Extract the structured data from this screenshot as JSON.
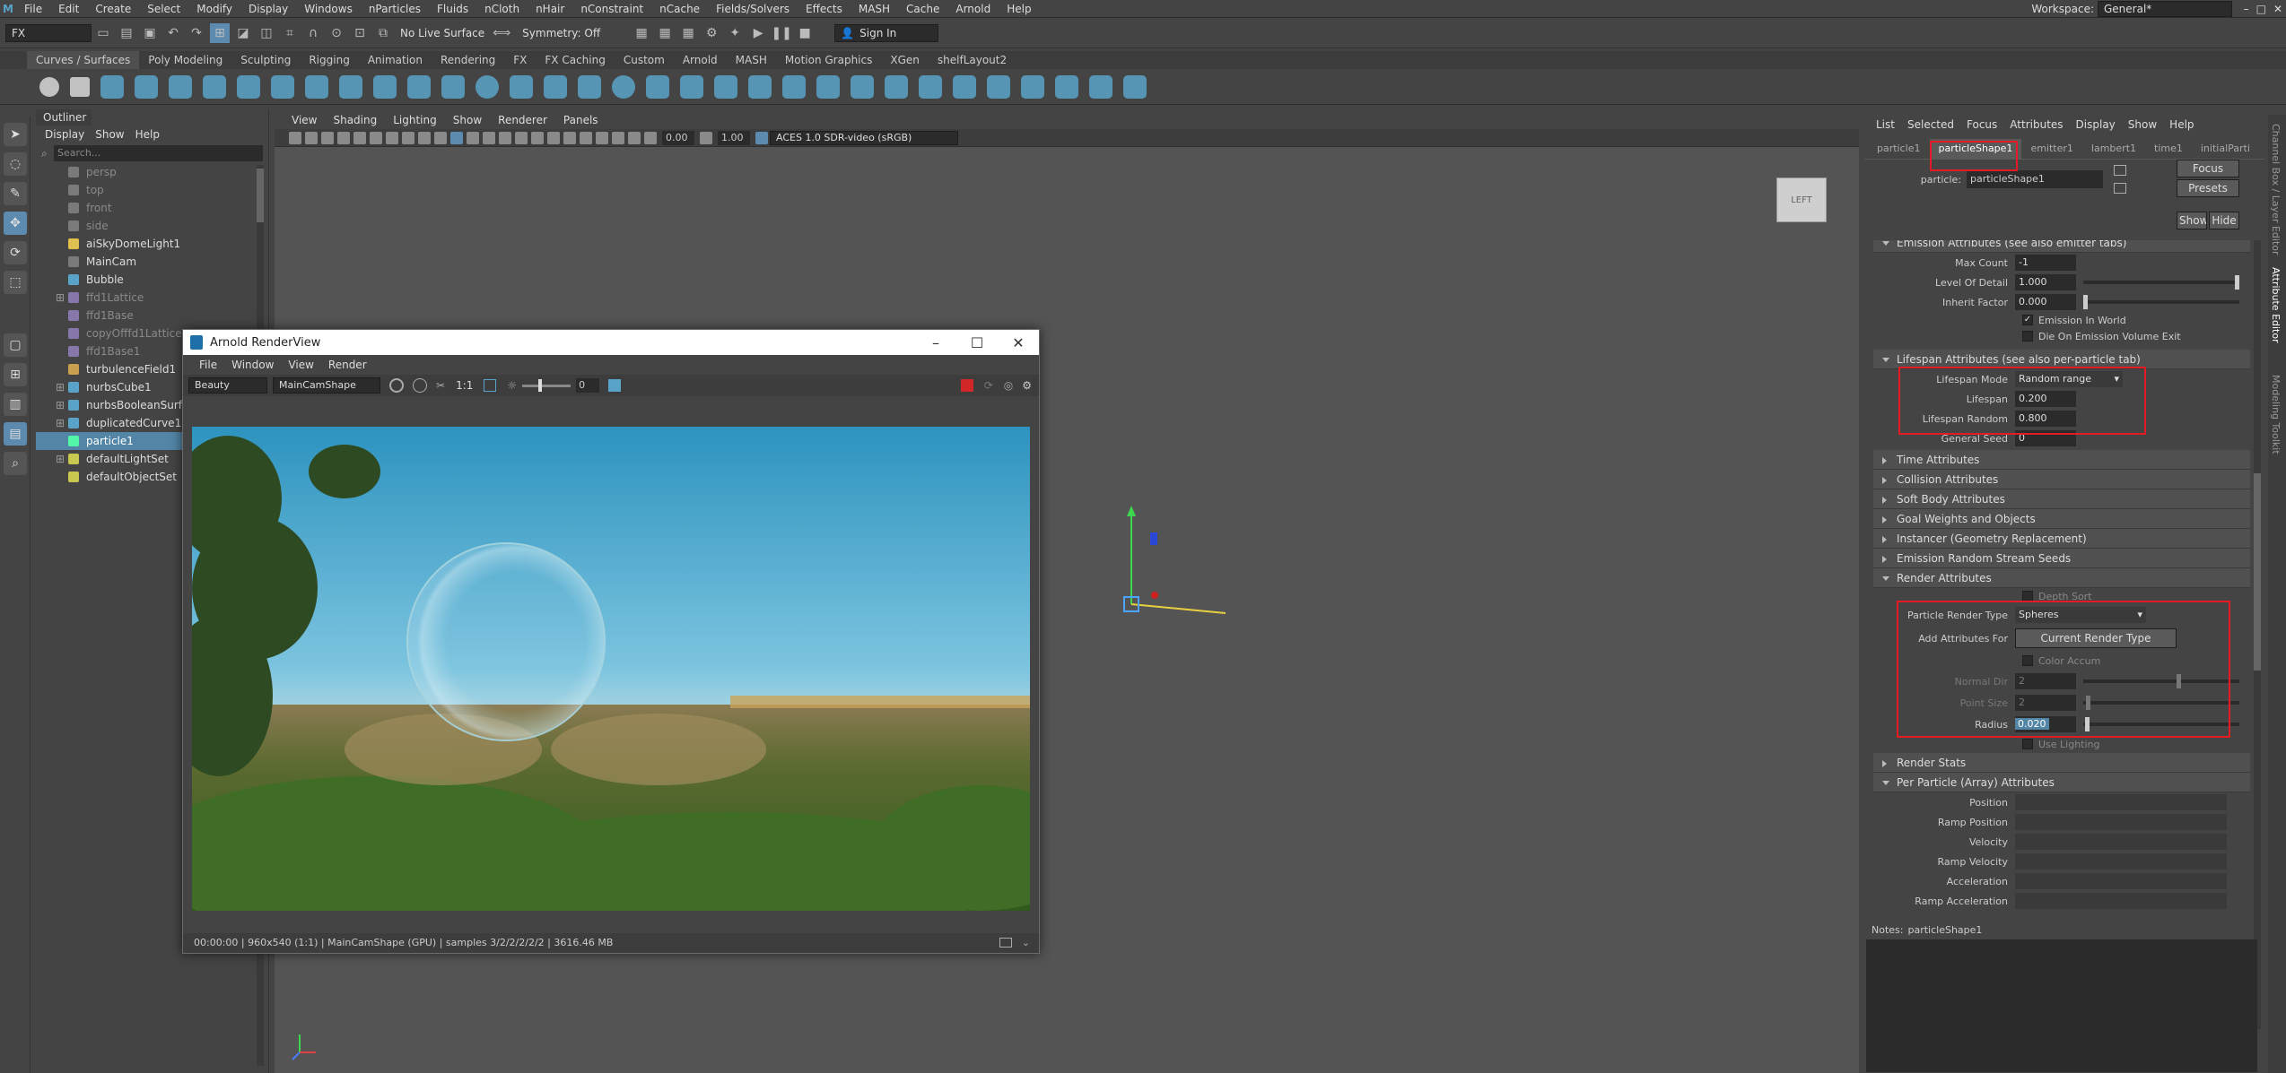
{
  "menubar": {
    "items": [
      "File",
      "Edit",
      "Create",
      "Select",
      "Modify",
      "Display",
      "Windows",
      "nParticles",
      "Fluids",
      "nCloth",
      "nHair",
      "nConstraint",
      "nCache",
      "Fields/Solvers",
      "Effects",
      "MASH",
      "Cache",
      "Arnold",
      "Help"
    ],
    "workspace_label": "Workspace:",
    "workspace_value": "General*"
  },
  "statusline": {
    "mode": "FX",
    "live_surface": "No Live Surface",
    "symmetry": "Symmetry: Off",
    "sign_in": "Sign In"
  },
  "shelf": {
    "tabs": [
      "Curves / Surfaces",
      "Poly Modeling",
      "Sculpting",
      "Rigging",
      "Animation",
      "Rendering",
      "FX",
      "FX Caching",
      "Custom",
      "Arnold",
      "MASH",
      "Motion Graphics",
      "XGen",
      "shelfLayout2"
    ]
  },
  "outliner": {
    "title": "Outliner",
    "menu": [
      "Display",
      "Show",
      "Help"
    ],
    "search_placeholder": "Search...",
    "items": [
      {
        "label": "persp",
        "dim": true
      },
      {
        "label": "top",
        "dim": true
      },
      {
        "label": "front",
        "dim": true
      },
      {
        "label": "side",
        "dim": true
      },
      {
        "label": "aiSkyDomeLight1"
      },
      {
        "label": "MainCam"
      },
      {
        "label": "Bubble"
      },
      {
        "label": "ffd1Lattice",
        "dim": true,
        "plus": true
      },
      {
        "label": "ffd1Base",
        "dim": true
      },
      {
        "label": "copyOfffd1Lattice",
        "dim": true
      },
      {
        "label": "ffd1Base1",
        "dim": true
      },
      {
        "label": "turbulenceField1"
      },
      {
        "label": "nurbsCube1",
        "plus": true
      },
      {
        "label": "nurbsBooleanSurface",
        "plus": true
      },
      {
        "label": "duplicatedCurve1",
        "plus": true
      },
      {
        "label": "particle1",
        "selected": true
      },
      {
        "label": "defaultLightSet",
        "plus": true
      },
      {
        "label": "defaultObjectSet"
      }
    ]
  },
  "viewport": {
    "menu": [
      "View",
      "Shading",
      "Lighting",
      "Show",
      "Renderer",
      "Panels"
    ],
    "field1": "0.00",
    "field2": "1.00",
    "colorspace": "ACES 1.0 SDR-video (sRGB)",
    "viewcube_label": "LEFT"
  },
  "renderview": {
    "title": "Arnold RenderView",
    "menu": [
      "File",
      "Window",
      "View",
      "Render"
    ],
    "aov": "Beauty",
    "camera": "MainCamShape",
    "ratio": "1:1",
    "exposure": "0",
    "status": "00:00:00 | 960x540 (1:1) | MainCamShape (GPU) | samples 3/2/2/2/2/2 | 3616.46 MB"
  },
  "attribute_editor": {
    "menu": [
      "List",
      "Selected",
      "Focus",
      "Attributes",
      "Display",
      "Show",
      "Help"
    ],
    "tabs": [
      "particle1",
      "particleShape1",
      "emitter1",
      "lambert1",
      "time1",
      "initialParti"
    ],
    "active_tab": "particleShape1",
    "node_label": "particle:",
    "node_value": "particleShape1",
    "buttons": {
      "focus": "Focus",
      "presets": "Presets",
      "show": "Show",
      "hide": "Hide"
    },
    "side_tabs": [
      "Channel Box / Layer Editor",
      "Attribute Editor",
      "Modeling Toolkit"
    ],
    "emission": {
      "title": "Emission Attributes (see also emitter tabs)",
      "max_count_label": "Max Count",
      "max_count": "-1",
      "lod_label": "Level Of Detail",
      "lod": "1.000",
      "inherit_label": "Inherit Factor",
      "inherit": "0.000",
      "emission_world": "Emission In World",
      "die_on_exit": "Die On Emission Volume Exit"
    },
    "lifespan": {
      "title": "Lifespan Attributes (see also per-particle tab)",
      "mode_label": "Lifespan Mode",
      "mode": "Random range",
      "lifespan_label": "Lifespan",
      "lifespan": "0.200",
      "random_label": "Lifespan Random",
      "random": "0.800",
      "seed_label": "General Seed",
      "seed": "0"
    },
    "collapsed_sections": [
      "Time Attributes",
      "Collision Attributes",
      "Soft Body Attributes",
      "Goal Weights and Objects",
      "Instancer (Geometry Replacement)",
      "Emission Random Stream Seeds"
    ],
    "render": {
      "title": "Render Attributes",
      "depth_sort": "Depth Sort",
      "type_label": "Particle Render Type",
      "type": "Spheres",
      "add_attr_label": "Add Attributes For",
      "add_attr_button": "Current Render Type",
      "color_accum": "Color Accum",
      "normal_dir_label": "Normal Dir",
      "normal_dir": "2",
      "point_size_label": "Point Size",
      "point_size": "2",
      "radius_label": "Radius",
      "radius": "0.020",
      "use_lighting": "Use Lighting"
    },
    "render_stats": "Render Stats",
    "per_particle": {
      "title": "Per Particle (Array) Attributes",
      "items": [
        "Position",
        "Ramp Position",
        "Velocity",
        "Ramp Velocity",
        "Acceleration",
        "Ramp Acceleration"
      ]
    },
    "notes_label": "Notes:",
    "notes_value": "particleShape1"
  },
  "colors": {
    "accent": "#5285a6",
    "highlight": "#e41b23",
    "particles": "#54f7a6"
  }
}
